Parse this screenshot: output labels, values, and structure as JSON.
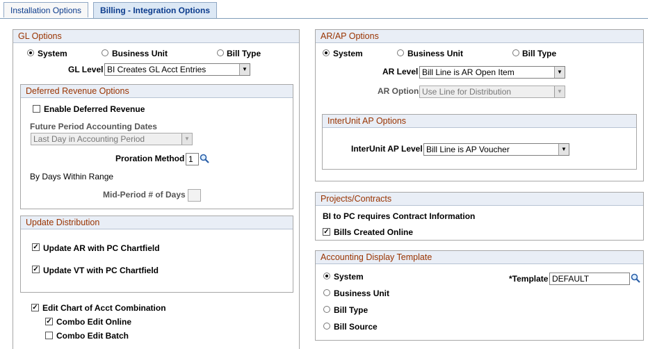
{
  "tabs": {
    "installation": "Installation Options",
    "billing": "Billing - Integration Options"
  },
  "gl": {
    "title": "GL Options",
    "radio_system": "System",
    "radio_bu": "Business Unit",
    "radio_billtype": "Bill Type",
    "gl_level_label": "GL Level",
    "gl_level_value": "BI Creates GL Acct Entries"
  },
  "deferred": {
    "title": "Deferred Revenue Options",
    "enable": "Enable Deferred Revenue",
    "future_label": "Future Period Accounting Dates",
    "future_value": "Last Day in Accounting Period",
    "proration_label": "Proration Method",
    "proration_value": "1",
    "by_days": "By Days Within Range",
    "mid_period": "Mid-Period # of Days"
  },
  "update": {
    "title": "Update Distribution",
    "ar": "Update AR with PC Chartfield",
    "vt": "Update VT with PC Chartfield"
  },
  "chart": {
    "edit": "Edit Chart of Acct Combination",
    "online": "Combo Edit Online",
    "batch": "Combo Edit Batch"
  },
  "arap": {
    "title": "AR/AP Options",
    "radio_system": "System",
    "radio_bu": "Business Unit",
    "radio_billtype": "Bill Type",
    "ar_level_label": "AR Level",
    "ar_level_value": "Bill Line is AR Open Item",
    "ar_option_label": "AR Option",
    "ar_option_value": "Use Line for Distribution"
  },
  "interunit": {
    "title": "InterUnit AP Options",
    "level_label": "InterUnit AP Level",
    "level_value": "Bill Line is AP Voucher"
  },
  "projects": {
    "title": "Projects/Contracts",
    "note": "BI to PC requires Contract Information",
    "bills_online": "Bills Created Online"
  },
  "adt": {
    "title": "Accounting Display Template",
    "system": "System",
    "bu": "Business Unit",
    "billtype": "Bill Type",
    "source": "Bill Source",
    "template_label": "*Template",
    "template_value": "DEFAULT"
  },
  "colors": {
    "section_title": "#993300",
    "tab_text": "#0b3b8c"
  }
}
